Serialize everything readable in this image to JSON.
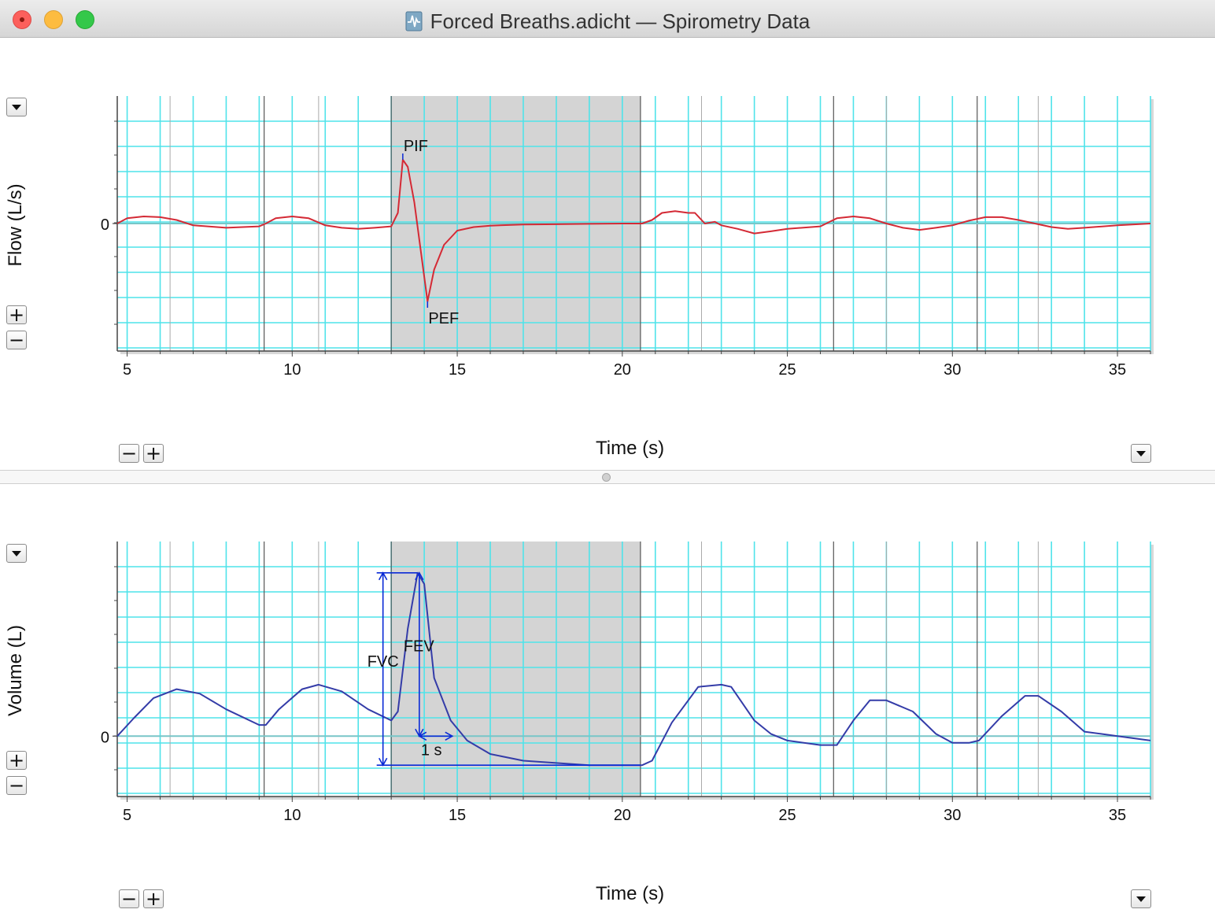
{
  "window": {
    "title": "Forced Breaths.adicht — Spirometry Data",
    "doc_icon": "waveform-document-icon"
  },
  "colors": {
    "grid_cyan": "#4fe3ea",
    "selection_gray": "#d4d4d4",
    "flow_trace": "#d42a35",
    "volume_trace": "#343ca8",
    "marker_blue": "#0a2bd6"
  },
  "x_axis": {
    "label": "Time (s)",
    "ticks": [
      5,
      10,
      15,
      20,
      25,
      30,
      35
    ],
    "range": [
      4.7,
      36
    ]
  },
  "selection": {
    "start": 13.0,
    "end": 20.55
  },
  "flow_panel": {
    "ylabel": "Flow (L/s)",
    "zero_label": "0",
    "markers": {
      "pif": "PIF",
      "pef": "PEF"
    }
  },
  "volume_panel": {
    "ylabel": "Volume (L)",
    "zero_label": "0",
    "markers": {
      "fvc": "FVC",
      "fev": "FEV",
      "one_s": "1 s"
    }
  },
  "chart_data": [
    {
      "type": "line",
      "ylabel": "Flow (L/s)",
      "xlabel": "Time (s)",
      "xlim": [
        4.7,
        36
      ],
      "ylim": [
        -3.6,
        3.6
      ],
      "series": [
        {
          "x": [
            4.7,
            5,
            5.5,
            6,
            6.5,
            7,
            8,
            9,
            9.2,
            9.5,
            10,
            10.5,
            11,
            11.5,
            12,
            12.5,
            13,
            13.2,
            13.35,
            13.5,
            13.7,
            14,
            14.1,
            14.3,
            14.6,
            15,
            15.5,
            16,
            17,
            18,
            19,
            20,
            20.6,
            20.9,
            21.2,
            21.6,
            22,
            22.2,
            22.5,
            22.8,
            23,
            23.5,
            24,
            24.5,
            25,
            26,
            26.5,
            27,
            27.5,
            28,
            28.5,
            29,
            29.5,
            30,
            30.5,
            31,
            31.5,
            32,
            32.5,
            33,
            33.5,
            34,
            35,
            36
          ],
          "y": [
            0,
            0.15,
            0.2,
            0.18,
            0.1,
            -0.05,
            -0.12,
            -0.08,
            0,
            0.15,
            0.2,
            0.15,
            -0.05,
            -0.12,
            -0.15,
            -0.12,
            -0.08,
            0.3,
            1.8,
            1.6,
            0.6,
            -1.5,
            -2.2,
            -1.3,
            -0.6,
            -0.2,
            -0.1,
            -0.06,
            -0.03,
            -0.02,
            -0.01,
            0,
            0,
            0.1,
            0.3,
            0.35,
            0.3,
            0.3,
            0,
            0.05,
            -0.05,
            -0.15,
            -0.28,
            -0.22,
            -0.15,
            -0.08,
            0.15,
            0.2,
            0.15,
            0,
            -0.12,
            -0.18,
            -0.12,
            -0.05,
            0.08,
            0.18,
            0.18,
            0.1,
            0,
            -0.1,
            -0.15,
            -0.12,
            -0.05,
            0
          ]
        }
      ],
      "annotations": [
        {
          "text": "PIF",
          "x": 13.35,
          "y": 1.8
        },
        {
          "text": "PEF",
          "x": 14.1,
          "y": -2.2
        }
      ]
    },
    {
      "type": "line",
      "ylabel": "Volume (L)",
      "xlabel": "Time (s)",
      "xlim": [
        4.7,
        36
      ],
      "ylim": [
        -1.35,
        4.35
      ],
      "series": [
        {
          "x": [
            4.7,
            5.2,
            5.8,
            6.5,
            7.2,
            8,
            9,
            9.2,
            9.6,
            10.3,
            10.8,
            11.5,
            12.3,
            13,
            13.2,
            13.5,
            13.8,
            14,
            14.3,
            14.8,
            15.3,
            16,
            17,
            18,
            19,
            20,
            20.6,
            20.9,
            21.5,
            22.3,
            23,
            23.3,
            24,
            24.5,
            25,
            26,
            26.5,
            27,
            27.5,
            28,
            28.8,
            29.5,
            30,
            30.5,
            30.8,
            31.5,
            32.2,
            32.6,
            33.3,
            34,
            34.5,
            35,
            36
          ],
          "y": [
            0,
            0.4,
            0.85,
            1.05,
            0.95,
            0.6,
            0.25,
            0.25,
            0.6,
            1.05,
            1.15,
            1,
            0.6,
            0.35,
            0.55,
            2.4,
            3.65,
            3.4,
            1.3,
            0.35,
            -0.1,
            -0.4,
            -0.55,
            -0.6,
            -0.65,
            -0.65,
            -0.65,
            -0.55,
            0.3,
            1.1,
            1.15,
            1.1,
            0.35,
            0.05,
            -0.1,
            -0.2,
            -0.2,
            0.35,
            0.8,
            0.8,
            0.55,
            0.05,
            -0.15,
            -0.15,
            -0.1,
            0.45,
            0.9,
            0.9,
            0.55,
            0.1,
            0.05,
            0,
            -0.1
          ]
        }
      ],
      "annotations": [
        {
          "text": "FVC",
          "x": 12.75,
          "y": 1.55
        },
        {
          "text": "FEV",
          "x": 14.0,
          "y": 1.9
        },
        {
          "text": "1 s",
          "x": 14.4,
          "y": -0.3
        }
      ]
    }
  ]
}
